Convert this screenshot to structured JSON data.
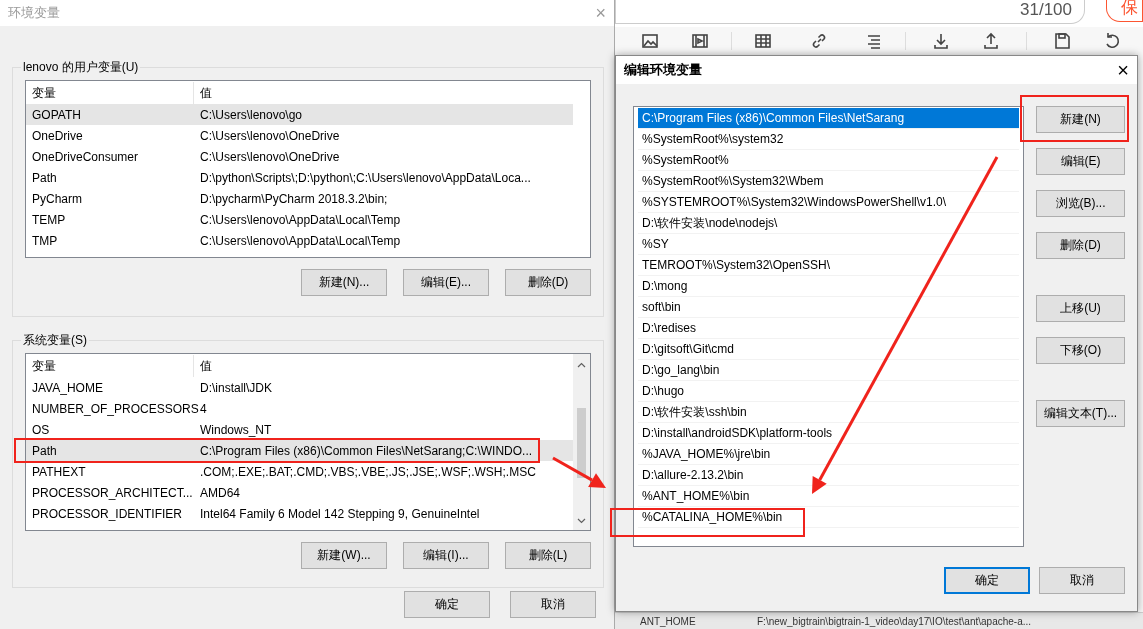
{
  "background_page": {
    "counter": "31/100",
    "save_button": "保",
    "table_row": {
      "name": "ANT_HOME",
      "value": "F:\\new_bigtrain\\bigtrain-1_video\\day17\\IO\\test\\ant\\apache-a..."
    }
  },
  "env_dialog": {
    "title": "环境变量",
    "close": "×",
    "user_group": {
      "title": "lenovo 的用户变量(U)",
      "columns": [
        "变量",
        "值"
      ],
      "rows": [
        {
          "name": "GOPATH",
          "value": "C:\\Users\\lenovo\\go",
          "selected": true
        },
        {
          "name": "OneDrive",
          "value": "C:\\Users\\lenovo\\OneDrive",
          "selected": false
        },
        {
          "name": "OneDriveConsumer",
          "value": "C:\\Users\\lenovo\\OneDrive",
          "selected": false
        },
        {
          "name": "Path",
          "value": "D:\\python\\Scripts\\;D:\\python\\;C:\\Users\\lenovo\\AppData\\Loca...",
          "selected": false
        },
        {
          "name": "PyCharm",
          "value": "D:\\pycharm\\PyCharm 2018.3.2\\bin;",
          "selected": false
        },
        {
          "name": "TEMP",
          "value": "C:\\Users\\lenovo\\AppData\\Local\\Temp",
          "selected": false
        },
        {
          "name": "TMP",
          "value": "C:\\Users\\lenovo\\AppData\\Local\\Temp",
          "selected": false
        }
      ],
      "buttons": [
        "新建(N)...",
        "编辑(E)...",
        "删除(D)"
      ]
    },
    "system_group": {
      "title": "系统变量(S)",
      "columns": [
        "变量",
        "值"
      ],
      "rows": [
        {
          "name": "JAVA_HOME",
          "value": "D:\\install\\JDK",
          "selected": false
        },
        {
          "name": "NUMBER_OF_PROCESSORS",
          "value": "4",
          "selected": false
        },
        {
          "name": "OS",
          "value": "Windows_NT",
          "selected": false
        },
        {
          "name": "Path",
          "value": "C:\\Program Files (x86)\\Common Files\\NetSarang;C:\\WINDO...",
          "selected": true
        },
        {
          "name": "PATHEXT",
          "value": ".COM;.EXE;.BAT;.CMD;.VBS;.VBE;.JS;.JSE;.WSF;.WSH;.MSC",
          "selected": false
        },
        {
          "name": "PROCESSOR_ARCHITECT...",
          "value": "AMD64",
          "selected": false
        },
        {
          "name": "PROCESSOR_IDENTIFIER",
          "value": "Intel64 Family 6 Model 142 Stepping 9, GenuineIntel",
          "selected": false
        }
      ],
      "buttons": [
        "新建(W)...",
        "编辑(I)...",
        "删除(L)"
      ]
    },
    "buttons": [
      "确定",
      "取消"
    ]
  },
  "edit_dialog": {
    "title": "编辑环境变量",
    "close": "×",
    "entries": [
      {
        "text": "C:\\Program Files (x86)\\Common Files\\NetSarang",
        "selected": true
      },
      {
        "text": "%SystemRoot%\\system32",
        "selected": false
      },
      {
        "text": "%SystemRoot%",
        "selected": false
      },
      {
        "text": "%SystemRoot%\\System32\\Wbem",
        "selected": false
      },
      {
        "text": "%SYSTEMROOT%\\System32\\WindowsPowerShell\\v1.0\\",
        "selected": false
      },
      {
        "text": "D:\\软件安装\\node\\nodejs\\",
        "selected": false
      },
      {
        "text": "%SY",
        "selected": false
      },
      {
        "text": "TEMROOT%\\System32\\OpenSSH\\",
        "selected": false
      },
      {
        "text": "D:\\mong",
        "selected": false
      },
      {
        "text": "soft\\bin",
        "selected": false
      },
      {
        "text": "D:\\redises",
        "selected": false
      },
      {
        "text": "D:\\gitsoft\\Git\\cmd",
        "selected": false
      },
      {
        "text": "D:\\go_lang\\bin",
        "selected": false
      },
      {
        "text": "D:\\hugo",
        "selected": false
      },
      {
        "text": "D:\\软件安装\\ssh\\bin",
        "selected": false
      },
      {
        "text": "D:\\install\\androidSDK\\platform-tools",
        "selected": false
      },
      {
        "text": "%JAVA_HOME%\\jre\\bin",
        "selected": false
      },
      {
        "text": "D:\\allure-2.13.2\\bin",
        "selected": false
      },
      {
        "text": "%ANT_HOME%\\bin",
        "selected": false
      },
      {
        "text": "%CATALINA_HOME%\\bin",
        "selected": false
      }
    ],
    "button_groups": [
      [
        "新建(N)",
        "编辑(E)",
        "浏览(B)...",
        "删除(D)"
      ],
      [
        "上移(U)",
        "下移(O)"
      ],
      [
        "编辑文本(T)..."
      ]
    ],
    "footer_buttons": [
      {
        "label": "确定",
        "default": true
      },
      {
        "label": "取消",
        "default": false
      }
    ]
  }
}
